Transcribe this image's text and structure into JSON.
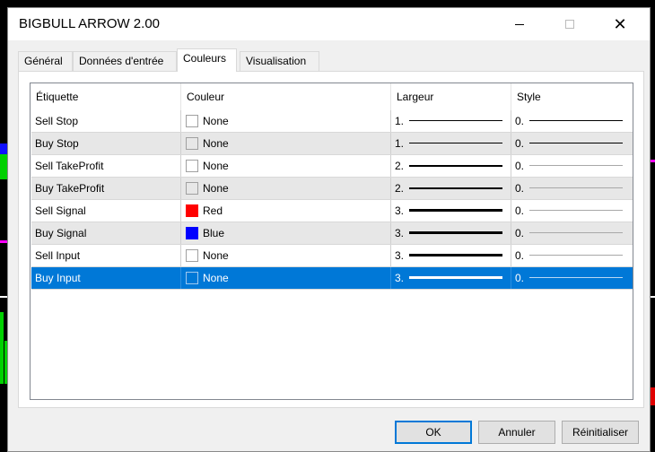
{
  "window": {
    "title": "BIGBULL ARROW 2.00",
    "minimize_icon": "minimize-icon",
    "maximize_icon": "maximize-icon",
    "close_glyph": "✕"
  },
  "tabs": [
    {
      "label": "Général"
    },
    {
      "label": "Données d'entrée"
    },
    {
      "label": "Couleurs"
    },
    {
      "label": "Visualisation"
    }
  ],
  "active_tab": "Couleurs",
  "table": {
    "headers": {
      "label": "Étiquette",
      "color": "Couleur",
      "width": "Largeur",
      "style": "Style"
    },
    "rows": [
      {
        "label": "Sell Stop",
        "color": "None",
        "swatch": "#ffffff",
        "width": "1.",
        "style": "0."
      },
      {
        "label": "Buy Stop",
        "color": "None",
        "swatch": "#e7e7e7",
        "width": "1.",
        "style": "0."
      },
      {
        "label": "Sell TakeProfit",
        "color": "None",
        "swatch": "#ffffff",
        "width": "2.",
        "style": "0."
      },
      {
        "label": "Buy TakeProfit",
        "color": "None",
        "swatch": "#e7e7e7",
        "width": "2.",
        "style": "0."
      },
      {
        "label": "Sell Signal",
        "color": "Red",
        "swatch": "#ff0000",
        "width": "3.",
        "style": "0."
      },
      {
        "label": "Buy Signal",
        "color": "Blue",
        "swatch": "#0000ff",
        "width": "3.",
        "style": "0."
      },
      {
        "label": "Sell Input",
        "color": "None",
        "swatch": "#ffffff",
        "width": "3.",
        "style": "0."
      },
      {
        "label": "Buy Input",
        "color": "None",
        "swatch": "#0078d7",
        "width": "3.",
        "style": "0."
      }
    ],
    "selected_row": "Buy Input"
  },
  "buttons": {
    "ok": "OK",
    "cancel": "Annuler",
    "reset": "Réinitialiser"
  },
  "colors": {
    "selection": "#0078d7",
    "alt_row": "#e7e7e7"
  }
}
